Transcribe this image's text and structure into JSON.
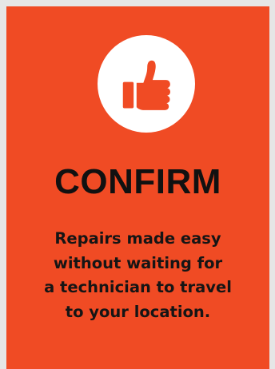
{
  "card": {
    "icon": "thumbs-up-icon",
    "title": "CONFIRM",
    "description_lines": [
      "Repairs made easy",
      "without waiting for",
      "a technician to travel",
      "to your location."
    ]
  },
  "colors": {
    "card_background": "#f04b24",
    "page_background": "#e6e6e6",
    "icon_circle": "#ffffff",
    "text": "#111111"
  }
}
